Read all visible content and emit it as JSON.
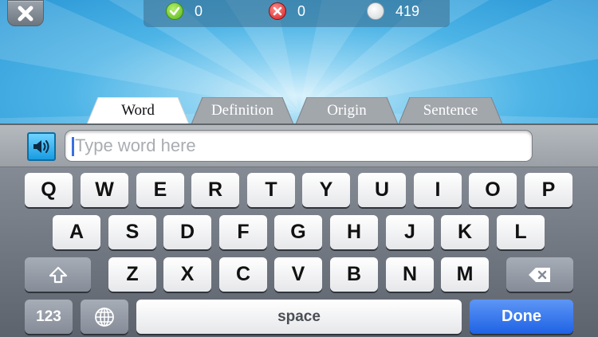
{
  "score_bar": {
    "correct": "0",
    "wrong": "0",
    "remaining": "419"
  },
  "tabs": [
    {
      "label": "Word",
      "active": true
    },
    {
      "label": "Definition",
      "active": false
    },
    {
      "label": "Origin",
      "active": false
    },
    {
      "label": "Sentence",
      "active": false
    }
  ],
  "input": {
    "placeholder": "Type word here",
    "value": ""
  },
  "keyboard": {
    "row1": [
      "Q",
      "W",
      "E",
      "R",
      "T",
      "Y",
      "U",
      "I",
      "O",
      "P"
    ],
    "row2": [
      "A",
      "S",
      "D",
      "F",
      "G",
      "H",
      "J",
      "K",
      "L"
    ],
    "row3": [
      "Z",
      "X",
      "C",
      "V",
      "B",
      "N",
      "M"
    ],
    "numbers_label": "123",
    "space_label": "space",
    "done_label": "Done"
  },
  "icons": {
    "close": "close-icon",
    "correct": "checkmark-icon",
    "wrong": "x-icon",
    "remaining": "circle-icon",
    "speaker": "speaker-icon",
    "shift": "shift-icon",
    "globe": "globe-icon",
    "backspace": "backspace-icon"
  },
  "colors": {
    "sky": "#2a97d6",
    "speaker_button": "#189ce2",
    "done_button": "#1f62e5",
    "keyboard_bg": "#5d636d"
  }
}
